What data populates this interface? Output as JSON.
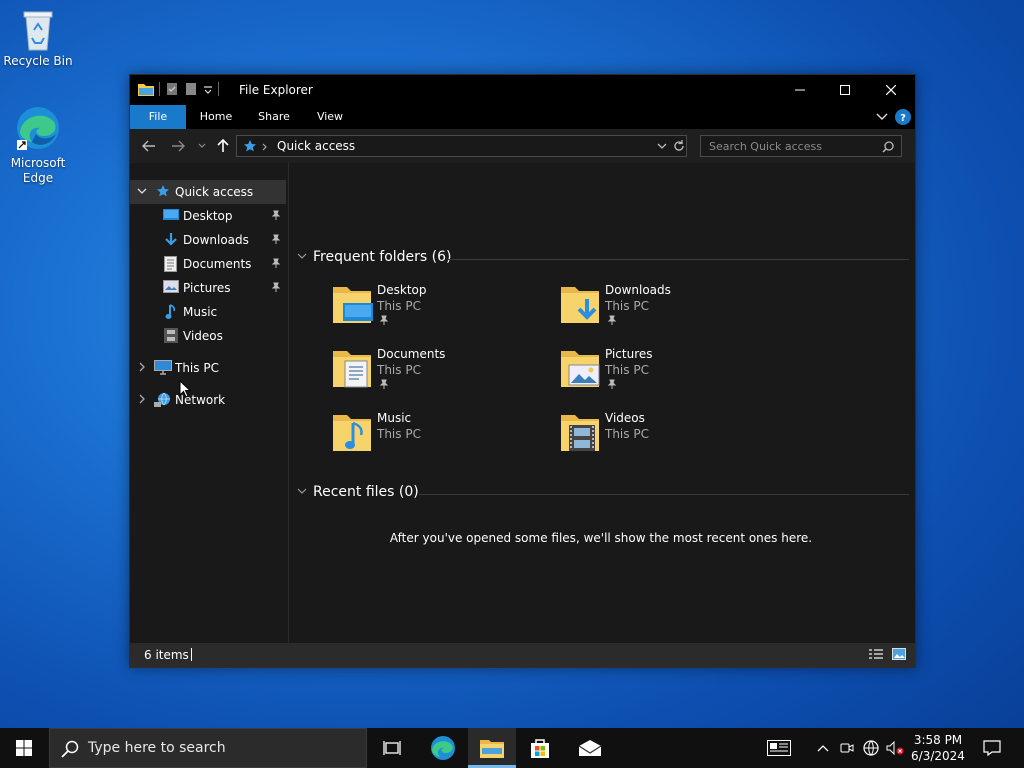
{
  "desktop": {
    "icons": [
      {
        "label": "Recycle Bin"
      },
      {
        "label": "Microsoft Edge"
      }
    ]
  },
  "window": {
    "title": "File Explorer",
    "ribbon_tabs": [
      "File",
      "Home",
      "Share",
      "View"
    ],
    "address": {
      "path": "Quick access"
    },
    "search": {
      "placeholder": "Search Quick access"
    },
    "nav_pane": {
      "items": [
        {
          "label": "Quick access",
          "icon": "star-icon",
          "selected": true
        },
        {
          "label": "Desktop",
          "icon": "desktop-folder-icon",
          "pinned": true
        },
        {
          "label": "Downloads",
          "icon": "download-arrow-icon",
          "pinned": true
        },
        {
          "label": "Documents",
          "icon": "document-icon",
          "pinned": true
        },
        {
          "label": "Pictures",
          "icon": "picture-icon",
          "pinned": true
        },
        {
          "label": "Music",
          "icon": "music-note-icon",
          "pinned": false
        },
        {
          "label": "Videos",
          "icon": "film-icon",
          "pinned": false
        },
        {
          "label": "This PC",
          "icon": "computer-icon"
        },
        {
          "label": "Network",
          "icon": "network-icon"
        }
      ]
    },
    "frequent_folders": {
      "header": "Frequent folders (6)",
      "items": [
        {
          "name": "Desktop",
          "location": "This PC",
          "pinned": true
        },
        {
          "name": "Downloads",
          "location": "This PC",
          "pinned": true
        },
        {
          "name": "Documents",
          "location": "This PC",
          "pinned": true
        },
        {
          "name": "Pictures",
          "location": "This PC",
          "pinned": true
        },
        {
          "name": "Music",
          "location": "This PC",
          "pinned": false
        },
        {
          "name": "Videos",
          "location": "This PC",
          "pinned": false
        }
      ]
    },
    "recent_files": {
      "header": "Recent files (0)",
      "empty_message": "After you've opened some files, we'll show the most recent ones here."
    },
    "status": {
      "items_count": "6 items"
    }
  },
  "taskbar": {
    "search_placeholder": "Type here to search",
    "clock": {
      "time": "3:58 PM",
      "date": "6/3/2024"
    },
    "accent_color": "#76b9ed"
  },
  "colors": {
    "ribbon_file_tab": "#1979ca",
    "window_bg": "#191919"
  }
}
